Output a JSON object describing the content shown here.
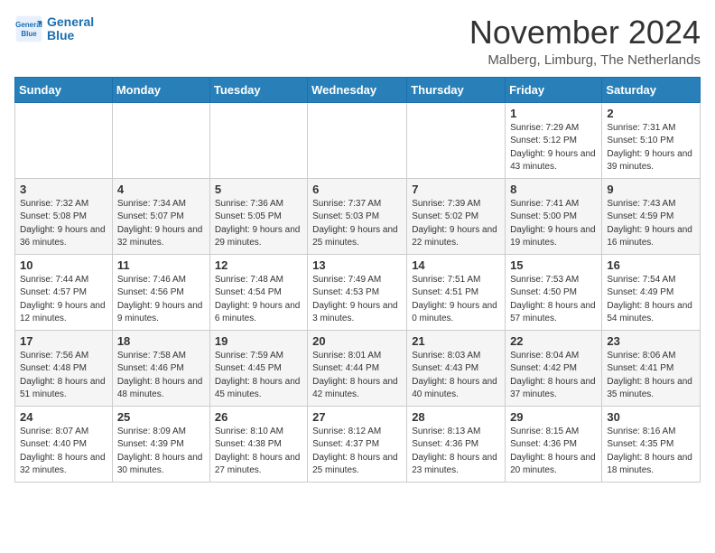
{
  "header": {
    "logo_line1": "General",
    "logo_line2": "Blue",
    "month": "November 2024",
    "location": "Malberg, Limburg, The Netherlands"
  },
  "weekdays": [
    "Sunday",
    "Monday",
    "Tuesday",
    "Wednesday",
    "Thursday",
    "Friday",
    "Saturday"
  ],
  "weeks": [
    [
      {
        "day": "",
        "info": ""
      },
      {
        "day": "",
        "info": ""
      },
      {
        "day": "",
        "info": ""
      },
      {
        "day": "",
        "info": ""
      },
      {
        "day": "",
        "info": ""
      },
      {
        "day": "1",
        "info": "Sunrise: 7:29 AM\nSunset: 5:12 PM\nDaylight: 9 hours and 43 minutes."
      },
      {
        "day": "2",
        "info": "Sunrise: 7:31 AM\nSunset: 5:10 PM\nDaylight: 9 hours and 39 minutes."
      }
    ],
    [
      {
        "day": "3",
        "info": "Sunrise: 7:32 AM\nSunset: 5:08 PM\nDaylight: 9 hours and 36 minutes."
      },
      {
        "day": "4",
        "info": "Sunrise: 7:34 AM\nSunset: 5:07 PM\nDaylight: 9 hours and 32 minutes."
      },
      {
        "day": "5",
        "info": "Sunrise: 7:36 AM\nSunset: 5:05 PM\nDaylight: 9 hours and 29 minutes."
      },
      {
        "day": "6",
        "info": "Sunrise: 7:37 AM\nSunset: 5:03 PM\nDaylight: 9 hours and 25 minutes."
      },
      {
        "day": "7",
        "info": "Sunrise: 7:39 AM\nSunset: 5:02 PM\nDaylight: 9 hours and 22 minutes."
      },
      {
        "day": "8",
        "info": "Sunrise: 7:41 AM\nSunset: 5:00 PM\nDaylight: 9 hours and 19 minutes."
      },
      {
        "day": "9",
        "info": "Sunrise: 7:43 AM\nSunset: 4:59 PM\nDaylight: 9 hours and 16 minutes."
      }
    ],
    [
      {
        "day": "10",
        "info": "Sunrise: 7:44 AM\nSunset: 4:57 PM\nDaylight: 9 hours and 12 minutes."
      },
      {
        "day": "11",
        "info": "Sunrise: 7:46 AM\nSunset: 4:56 PM\nDaylight: 9 hours and 9 minutes."
      },
      {
        "day": "12",
        "info": "Sunrise: 7:48 AM\nSunset: 4:54 PM\nDaylight: 9 hours and 6 minutes."
      },
      {
        "day": "13",
        "info": "Sunrise: 7:49 AM\nSunset: 4:53 PM\nDaylight: 9 hours and 3 minutes."
      },
      {
        "day": "14",
        "info": "Sunrise: 7:51 AM\nSunset: 4:51 PM\nDaylight: 9 hours and 0 minutes."
      },
      {
        "day": "15",
        "info": "Sunrise: 7:53 AM\nSunset: 4:50 PM\nDaylight: 8 hours and 57 minutes."
      },
      {
        "day": "16",
        "info": "Sunrise: 7:54 AM\nSunset: 4:49 PM\nDaylight: 8 hours and 54 minutes."
      }
    ],
    [
      {
        "day": "17",
        "info": "Sunrise: 7:56 AM\nSunset: 4:48 PM\nDaylight: 8 hours and 51 minutes."
      },
      {
        "day": "18",
        "info": "Sunrise: 7:58 AM\nSunset: 4:46 PM\nDaylight: 8 hours and 48 minutes."
      },
      {
        "day": "19",
        "info": "Sunrise: 7:59 AM\nSunset: 4:45 PM\nDaylight: 8 hours and 45 minutes."
      },
      {
        "day": "20",
        "info": "Sunrise: 8:01 AM\nSunset: 4:44 PM\nDaylight: 8 hours and 42 minutes."
      },
      {
        "day": "21",
        "info": "Sunrise: 8:03 AM\nSunset: 4:43 PM\nDaylight: 8 hours and 40 minutes."
      },
      {
        "day": "22",
        "info": "Sunrise: 8:04 AM\nSunset: 4:42 PM\nDaylight: 8 hours and 37 minutes."
      },
      {
        "day": "23",
        "info": "Sunrise: 8:06 AM\nSunset: 4:41 PM\nDaylight: 8 hours and 35 minutes."
      }
    ],
    [
      {
        "day": "24",
        "info": "Sunrise: 8:07 AM\nSunset: 4:40 PM\nDaylight: 8 hours and 32 minutes."
      },
      {
        "day": "25",
        "info": "Sunrise: 8:09 AM\nSunset: 4:39 PM\nDaylight: 8 hours and 30 minutes."
      },
      {
        "day": "26",
        "info": "Sunrise: 8:10 AM\nSunset: 4:38 PM\nDaylight: 8 hours and 27 minutes."
      },
      {
        "day": "27",
        "info": "Sunrise: 8:12 AM\nSunset: 4:37 PM\nDaylight: 8 hours and 25 minutes."
      },
      {
        "day": "28",
        "info": "Sunrise: 8:13 AM\nSunset: 4:36 PM\nDaylight: 8 hours and 23 minutes."
      },
      {
        "day": "29",
        "info": "Sunrise: 8:15 AM\nSunset: 4:36 PM\nDaylight: 8 hours and 20 minutes."
      },
      {
        "day": "30",
        "info": "Sunrise: 8:16 AM\nSunset: 4:35 PM\nDaylight: 8 hours and 18 minutes."
      }
    ]
  ]
}
